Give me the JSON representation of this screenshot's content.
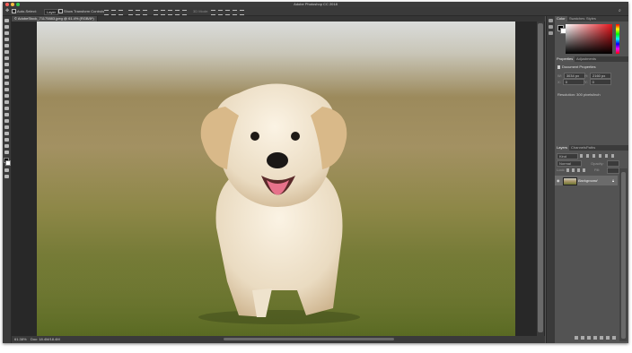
{
  "app": {
    "title": "Adobe Photoshop CC 2018"
  },
  "options_bar": {
    "auto_select_label": "Auto-Select:",
    "auto_select_value": "Layer",
    "show_transform_label": "Show Transform Controls",
    "mode_3d_label": "3D Mode:"
  },
  "document": {
    "tab_label": "© AdobeStock_71175883.jpeg @ 61.4% (RGB/8*)"
  },
  "status": {
    "zoom": "61.38%",
    "doc_size": "Doc: 18.4M/18.4M"
  },
  "color_panel": {
    "tabs": [
      "Color",
      "Swatches",
      "Styles"
    ]
  },
  "properties_panel": {
    "tabs": [
      "Properties",
      "Adjustments"
    ],
    "header": "Document Properties",
    "w_label": "W:",
    "w_value": "3034 px",
    "h_label": "H:",
    "h_value": "2160 px",
    "x_label": "X:",
    "x_value": "0",
    "y_label": "Y:",
    "y_value": "0",
    "resolution": "Resolution: 300 pixels/inch"
  },
  "layers_panel": {
    "tabs": [
      "Layers",
      "Channels",
      "Paths"
    ],
    "kind_filter": "Kind",
    "blend_mode": "Normal",
    "opacity_label": "Opacity:",
    "lock_label": "Lock:",
    "fill_label": "Fill:",
    "layers": [
      {
        "name": "Background",
        "visible": true,
        "locked": true
      }
    ]
  },
  "icons": {
    "eye": "eye-icon",
    "lock": "lock-icon"
  },
  "colors": {
    "fg": "#000000",
    "bg": "#ffffff",
    "picker": "#e6141b"
  }
}
